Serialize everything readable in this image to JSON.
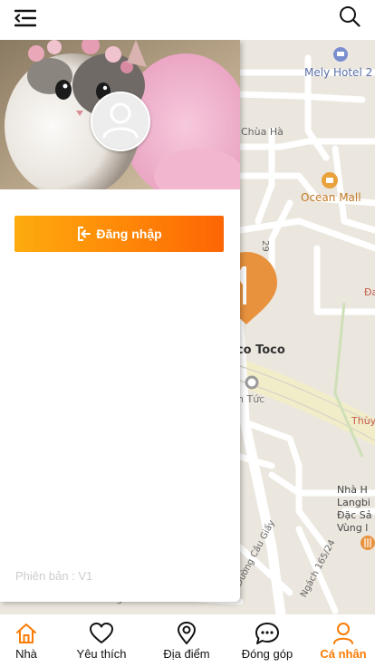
{
  "header": {
    "menu_icon": "menu-collapse-icon",
    "search_icon": "search-icon"
  },
  "map": {
    "labels": {
      "hotel": "Mely Hotel 2",
      "chua": "Chùa Hà",
      "ocean": "Ocean Mall",
      "toco": "oco Toco",
      "tuc": "n Tức",
      "thuy": "Thùy",
      "da": "Đa",
      "nha_line1": "Nhà H",
      "nha_line2": "Langbi",
      "nha_line3": "Đặc Sả",
      "nha_line4": "Vùng l",
      "num_29": "29",
      "duong": "Đường Cầu Giấy",
      "ngach": "Ngách 165/24",
      "ung": "ung"
    },
    "marker_icon": "restaurant-icon"
  },
  "profile_panel": {
    "avatar_icon": "user-avatar-icon",
    "login_label": "Đăng nhập",
    "login_icon": "login-icon",
    "version_text": "Phiên bản  :  V1"
  },
  "bottom_nav": {
    "items": [
      {
        "label": "Nhà",
        "icon": "home-icon",
        "active": false
      },
      {
        "label": "Yêu thích",
        "icon": "heart-icon",
        "active": false
      },
      {
        "label": "Địa điểm",
        "icon": "location-pin-icon",
        "active": false
      },
      {
        "label": "Đóng góp",
        "icon": "chat-bubble-icon",
        "active": false
      },
      {
        "label": "Cá nhân",
        "icon": "person-icon",
        "active": true
      }
    ]
  },
  "colors": {
    "accent": "#fb7c05",
    "gradient_start": "#fdab0e",
    "gradient_end": "#fd6504",
    "map_background": "#ebe7df",
    "marker": "#e8923e"
  }
}
